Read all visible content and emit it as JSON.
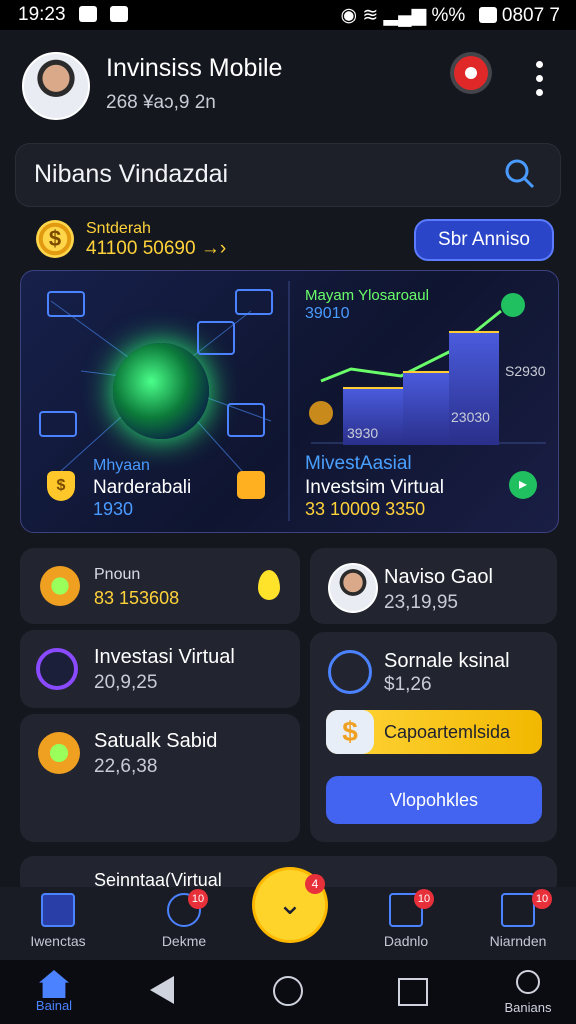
{
  "status_bar": {
    "time": "19:23",
    "right": "0807 7",
    "battery": "%%"
  },
  "header": {
    "title": "Invinsiss Mobile",
    "subtitle": "268 ¥aɔ,9 2n"
  },
  "search": {
    "text": "Nibans Vindazdai"
  },
  "balance": {
    "label": "Sntderah",
    "amount": "41100 50690 →›",
    "button": "Sbr Anniso"
  },
  "hero": {
    "chart_title": "Mayam Ylosaroaul",
    "chart_value": "39010",
    "label_right_top": "S2930",
    "label_mid": "23030",
    "label_bottom": "3930",
    "left_label1": "Mhyaan",
    "left_label2": "Narderabali",
    "left_value": "1930",
    "right_label1": "MivestAasial",
    "right_label2": "Investsim Virtual",
    "right_value": "33 10009 3350"
  },
  "tiles": {
    "t1": {
      "title": "Pnoun",
      "value": "83 153608"
    },
    "t2": {
      "title": "Naviso Gaol",
      "value": "23,19,95"
    },
    "t3": {
      "title": "Investasi Virtual",
      "value": "20,9,25"
    },
    "t4": {
      "title": "Sornale ksinal",
      "value": "$1,26"
    },
    "t5": {
      "title": "Satualk Sabid",
      "value": "22,6,38"
    },
    "yellow_button": "Capoartemlsida",
    "blue_button": "Vlopohkles"
  },
  "partial_card": "Seinntaa(Virtual",
  "bottom_nav": [
    {
      "label": "Iwenctas",
      "badge": ""
    },
    {
      "label": "Dekme",
      "badge": "10"
    },
    {
      "label": "Dadnlo",
      "badge": "10"
    },
    {
      "label": "Niarnden",
      "badge": "10"
    }
  ],
  "fab_badge": "4",
  "system_nav": {
    "home_label": "Bainal",
    "search_label": "Banians"
  }
}
